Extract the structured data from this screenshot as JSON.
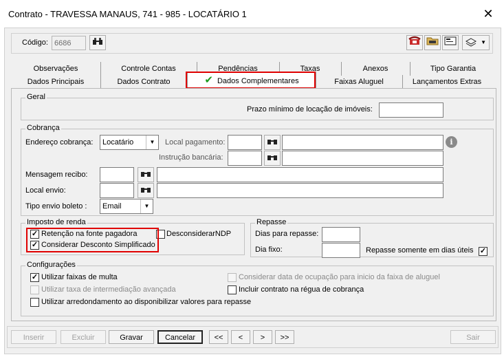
{
  "window": {
    "title": "Contrato - TRAVESSA MANAUS, 741 - 985 - LOCATÁRIO 1",
    "close_glyph": "✕"
  },
  "codigo": {
    "label": "Código:",
    "value": "6686"
  },
  "tabs_row1": [
    "Observações",
    "Controle Contas",
    "Pendências",
    "Taxas",
    "Anexos",
    "Tipo Garantia"
  ],
  "tabs_row2": [
    "Dados Principais",
    "Dados Contrato",
    "Dados Complementares",
    "Faixas Aluguel",
    "Lançamentos Extras"
  ],
  "active_tab_check": "✔",
  "geral": {
    "legend": "Geral",
    "prazo_label": "Prazo mínimo de locação de imóveis:",
    "prazo_value": ""
  },
  "cobranca": {
    "legend": "Cobrança",
    "endereco_label": "Endereço cobrança:",
    "endereco_value": "Locatário",
    "local_pagamento_label": "Local pagamento:",
    "instrucao_label": "Instrução bancária:",
    "mensagem_label": "Mensagem recibo:",
    "local_envio_label": "Local envio:",
    "tipo_envio_label": "Tipo envio boleto :",
    "tipo_envio_value": "Email",
    "info_glyph": "i"
  },
  "imposto": {
    "legend": "Imposto de renda",
    "retencao_label": "Retenção na fonte pagadora",
    "retencao_checked": true,
    "desconsiderar_label": "DesconsiderarNDP",
    "desconsiderar_checked": false,
    "desconto_label": "Considerar Desconto Simplificado",
    "desconto_checked": true
  },
  "repasse": {
    "legend": "Repasse",
    "dias_label": "Dias para repasse:",
    "dia_fixo_label": "Dia fixo:",
    "somente_label": "Repasse somente em dias úteis",
    "somente_checked": true
  },
  "config": {
    "legend": "Configurações",
    "faixas_multa": "Utilizar faixas de multa",
    "taxa_intermediacao": "Utilizar taxa de intermediação avançada",
    "arredondamento": "Utilizar arredondamento ao disponibilizar valores para repasse",
    "data_ocupacao": "Considerar data de ocupação para inicio da faixa de aluguel",
    "regua_cobranca": "Incluir contrato na régua de cobrança"
  },
  "buttons": {
    "inserir": "Inserir",
    "excluir": "Excluir",
    "gravar": "Gravar",
    "cancelar": "Cancelar",
    "first": "<<",
    "prev": "<",
    "next": ">",
    "last": ">>",
    "sair": "Sair"
  },
  "icons": {
    "binoculars": "binoculars-icon",
    "phone": "phone-icon",
    "folder": "folder-icon",
    "card": "card-icon",
    "layers": "layers-icon"
  }
}
